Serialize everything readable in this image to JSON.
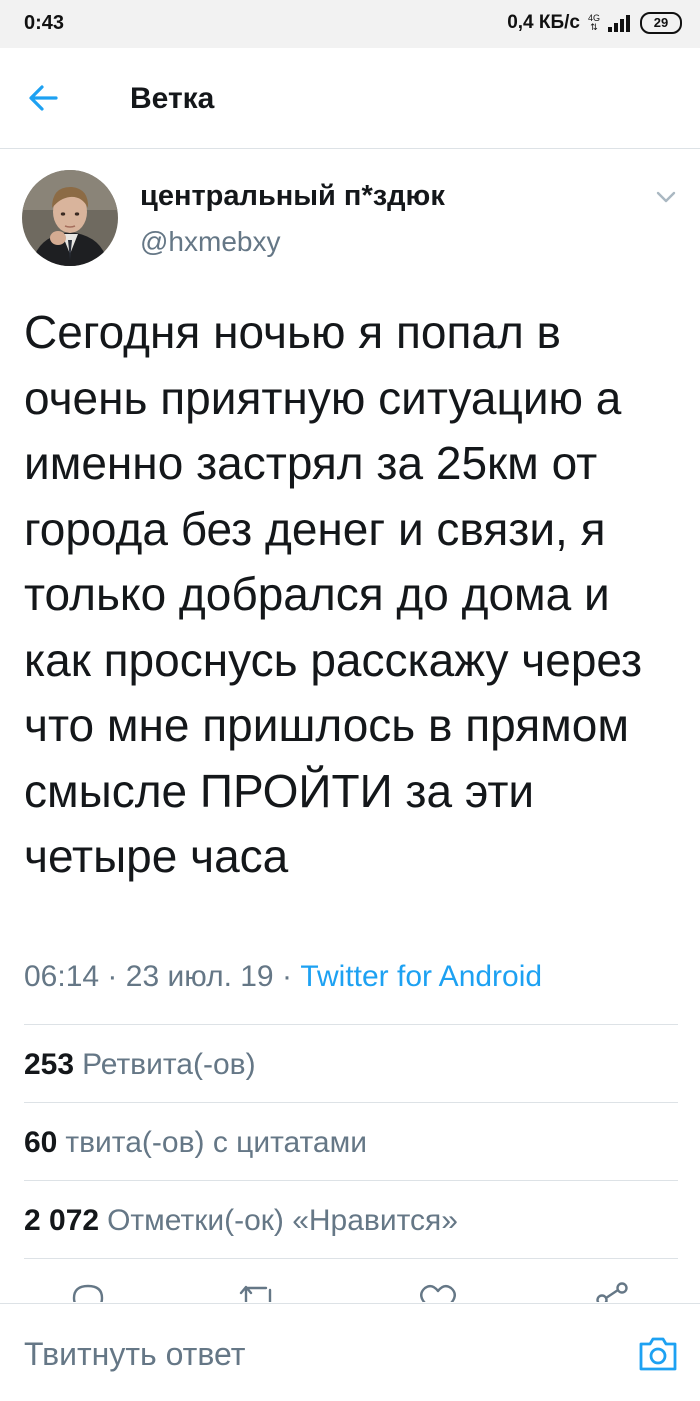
{
  "status_bar": {
    "time": "0:43",
    "net_speed": "0,4 КБ/с",
    "network_type": "4G",
    "battery": "29"
  },
  "header": {
    "back_icon": "arrow-left-icon",
    "title": "Ветка"
  },
  "tweet": {
    "author_name": "центральный п*здюк",
    "author_handle": "@hxmebxy",
    "text": "Сегодня ночью я попал в очень приятную ситуацию а именно застрял за 25км от города без денег и связи, я только добрался до дома и как проснусь расскажу через что мне пришлось в прямом смысле ПРОЙТИ за эти четыре часа",
    "time": "06:14",
    "date": "23 июл. 19",
    "separator": "·",
    "source": "Twitter for Android"
  },
  "stats": {
    "retweets_count": "253",
    "retweets_label": "Ретвита(-ов)",
    "quotes_count": "60",
    "quotes_label": "твита(-ов) с цитатами",
    "likes_count": "2 072",
    "likes_label": "Отметки(-ок) «Нравится»"
  },
  "actions": [
    "reply-icon",
    "retweet-icon",
    "like-icon",
    "share-icon"
  ],
  "reply_bar": {
    "placeholder": "Твитнуть ответ",
    "camera_icon": "camera-icon"
  },
  "colors": {
    "accent": "#1da1f2",
    "text_primary": "#14171a",
    "text_secondary": "#657786",
    "divider": "#dde2e6",
    "status_bar_bg": "#f2f2f2"
  }
}
